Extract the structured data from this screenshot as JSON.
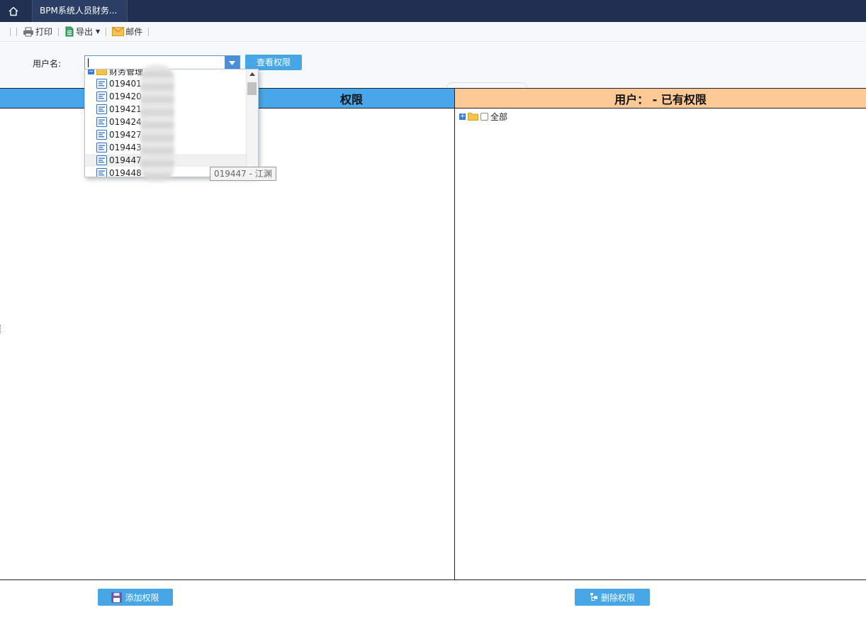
{
  "topbar": {
    "tab_title": "BPM系统人员财务..."
  },
  "toolbar": {
    "print_label": "打印",
    "export_label": "导出",
    "mail_label": "邮件"
  },
  "query": {
    "username_label": "用户名:",
    "query_button": "查看权限",
    "username_value": ""
  },
  "left_panel": {
    "header": "权限"
  },
  "right_panel": {
    "header": "用户：  - 已有权限",
    "tree_root": "全部"
  },
  "dropdown": {
    "group_label": "财务管理",
    "items": [
      {
        "code": "019401",
        "name": ""
      },
      {
        "code": "019420",
        "name": ""
      },
      {
        "code": "019421",
        "name": ""
      },
      {
        "code": "019424 -",
        "name": ""
      },
      {
        "code": "019427 -",
        "name": ""
      },
      {
        "code": "019443 -",
        "name": ""
      },
      {
        "code": "019447 -",
        "name": ""
      },
      {
        "code": "019448 -",
        "name": ""
      }
    ]
  },
  "tooltip": {
    "text": "019447 - 江渊"
  },
  "actions": {
    "add_label": "添加权限",
    "delete_label": "删除权限"
  },
  "colors": {
    "topbar": "#1f3050",
    "accent": "#47a6e6",
    "left_header": "#48a7ea",
    "right_header": "#fcc994"
  }
}
